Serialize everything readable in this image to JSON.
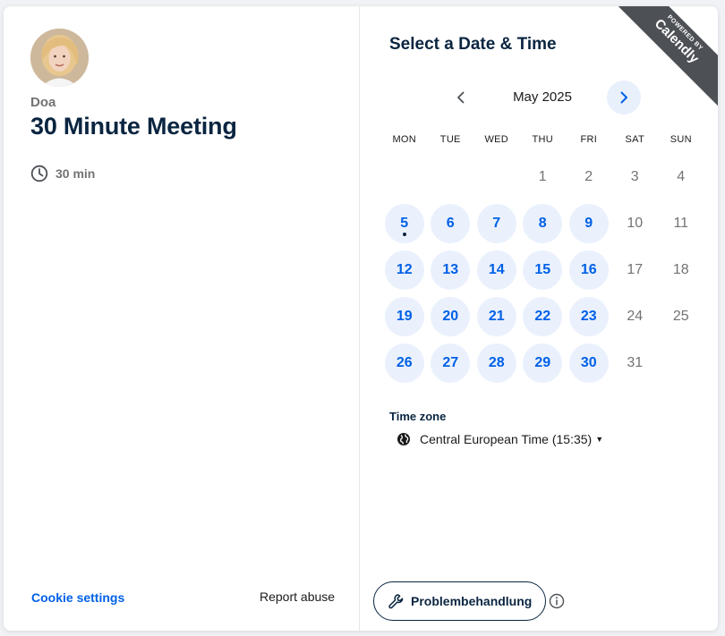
{
  "event": {
    "host_name": "Doa",
    "title": "30 Minute Meeting",
    "duration": "30 min"
  },
  "footer": {
    "cookie_settings": "Cookie settings",
    "report_abuse": "Report abuse"
  },
  "scheduler": {
    "heading": "Select a Date & Time",
    "badge_small": "POWERED BY",
    "badge_brand": "Calendly",
    "month": "May 2025",
    "weekdays": [
      "MON",
      "TUE",
      "WED",
      "THU",
      "FRI",
      "SAT",
      "SUN"
    ],
    "leading_blanks": 3,
    "days": [
      {
        "n": "1",
        "available": false
      },
      {
        "n": "2",
        "available": false
      },
      {
        "n": "3",
        "available": false
      },
      {
        "n": "4",
        "available": false
      },
      {
        "n": "5",
        "available": true,
        "today": true
      },
      {
        "n": "6",
        "available": true
      },
      {
        "n": "7",
        "available": true
      },
      {
        "n": "8",
        "available": true
      },
      {
        "n": "9",
        "available": true
      },
      {
        "n": "10",
        "available": false
      },
      {
        "n": "11",
        "available": false
      },
      {
        "n": "12",
        "available": true
      },
      {
        "n": "13",
        "available": true
      },
      {
        "n": "14",
        "available": true
      },
      {
        "n": "15",
        "available": true
      },
      {
        "n": "16",
        "available": true
      },
      {
        "n": "17",
        "available": false
      },
      {
        "n": "18",
        "available": false
      },
      {
        "n": "19",
        "available": true
      },
      {
        "n": "20",
        "available": true
      },
      {
        "n": "21",
        "available": true
      },
      {
        "n": "22",
        "available": true
      },
      {
        "n": "23",
        "available": true
      },
      {
        "n": "24",
        "available": false
      },
      {
        "n": "25",
        "available": false
      },
      {
        "n": "26",
        "available": true
      },
      {
        "n": "27",
        "available": true
      },
      {
        "n": "28",
        "available": true
      },
      {
        "n": "29",
        "available": true
      },
      {
        "n": "30",
        "available": true
      },
      {
        "n": "31",
        "available": false
      }
    ],
    "timezone_label": "Time zone",
    "timezone_value": "Central European Time (15:35)",
    "troubleshoot_label": "Problembehandlung"
  },
  "colors": {
    "accent": "#0060e6",
    "available_bg": "#eaf1fd",
    "heading": "#0a2540",
    "badge": "#4d5055"
  },
  "icons": {
    "duration": "clock-icon",
    "prev": "chevron-left-icon",
    "next": "chevron-right-icon",
    "timezone": "globe-icon",
    "troubleshoot": "wrench-icon",
    "info": "info-icon"
  }
}
